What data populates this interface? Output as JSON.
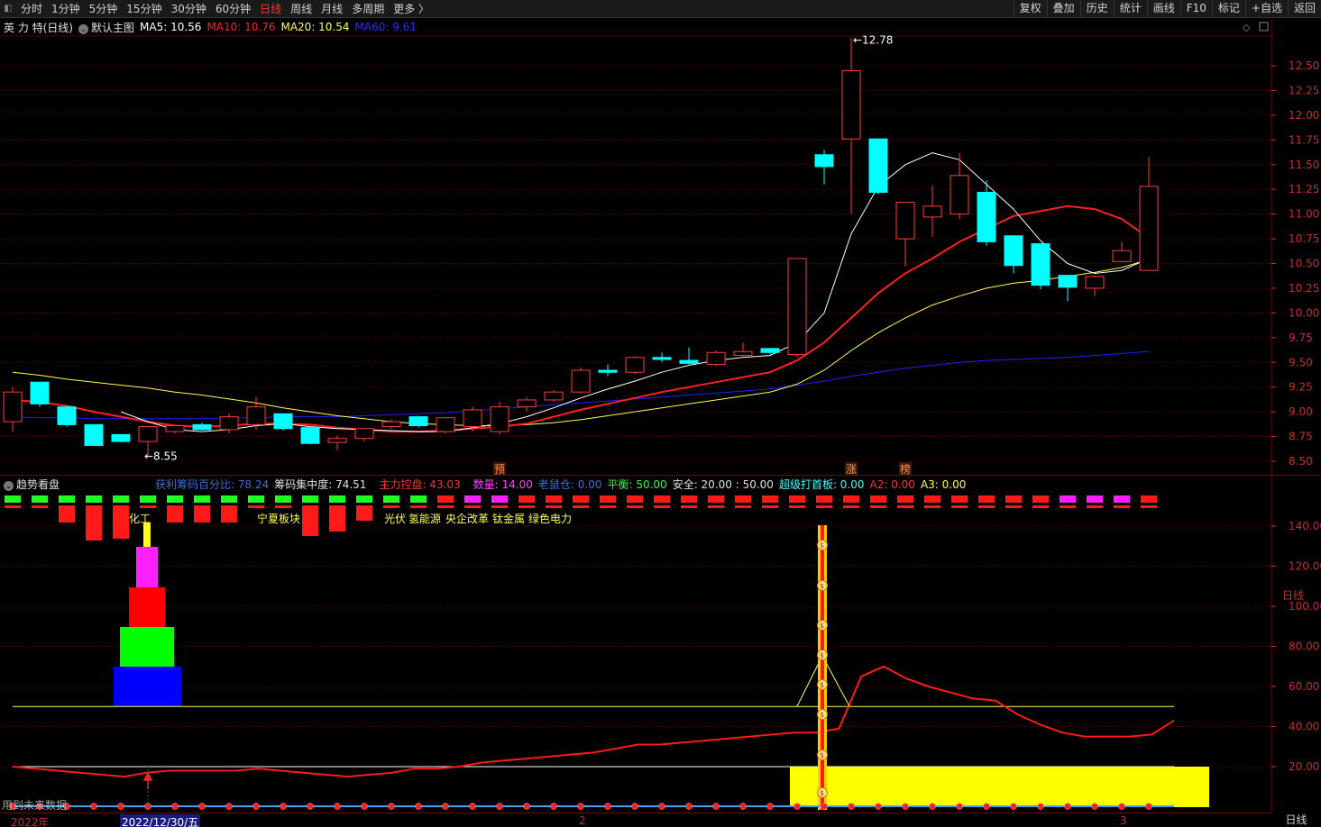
{
  "toolbar": {
    "periods": [
      {
        "label": "分时",
        "active": false
      },
      {
        "label": "1分钟",
        "active": false
      },
      {
        "label": "5分钟",
        "active": false
      },
      {
        "label": "15分钟",
        "active": false
      },
      {
        "label": "30分钟",
        "active": false
      },
      {
        "label": "60分钟",
        "active": false
      },
      {
        "label": "日线",
        "active": true
      },
      {
        "label": "周线",
        "active": false
      },
      {
        "label": "月线",
        "active": false
      },
      {
        "label": "多周期",
        "active": false
      },
      {
        "label": "更多 〉",
        "active": false
      }
    ],
    "right_buttons": [
      "复权",
      "叠加",
      "历史",
      "统计",
      "画线",
      "F10",
      "标记",
      "+自选",
      "返回"
    ]
  },
  "infobar": {
    "stock_name": "英 力 特(日线)",
    "template": "默认主图",
    "ma5": "MA5: 10.56",
    "ma10": "MA10: 10.76",
    "ma20": "MA20: 10.54",
    "ma60": "MA60: 9.61"
  },
  "colors": {
    "up": "#ff3b3b",
    "down": "#00ffff",
    "ma5": "#ffffff",
    "ma10": "#ff2020",
    "ma20": "#ffff50",
    "ma60": "#2020ff",
    "grid": "#5a0000"
  },
  "price_axis": {
    "ticks": [
      12.5,
      12.25,
      12.0,
      11.75,
      11.5,
      11.25,
      11.0,
      10.75,
      10.5,
      10.25,
      10.0,
      9.75,
      9.5,
      9.25,
      9.0,
      8.75,
      8.5
    ]
  },
  "annotations": {
    "high": "12.78",
    "low": "8.55",
    "marker_yu": "预",
    "marker_zhang": "涨",
    "marker_bang": "榜"
  },
  "chart_data": {
    "type": "candlestick",
    "ylim": [
      8.35,
      12.95
    ],
    "candles": [
      {
        "o": 8.9,
        "h": 9.25,
        "l": 8.8,
        "c": 9.2
      },
      {
        "o": 9.3,
        "h": 9.3,
        "l": 9.05,
        "c": 9.08
      },
      {
        "o": 9.05,
        "h": 9.05,
        "l": 8.85,
        "c": 8.87
      },
      {
        "o": 8.87,
        "h": 8.87,
        "l": 8.65,
        "c": 8.66
      },
      {
        "o": 8.77,
        "h": 8.77,
        "l": 8.69,
        "c": 8.7
      },
      {
        "o": 8.7,
        "h": 8.86,
        "l": 8.55,
        "c": 8.85
      },
      {
        "o": 8.8,
        "h": 8.87,
        "l": 8.78,
        "c": 8.86
      },
      {
        "o": 8.87,
        "h": 8.89,
        "l": 8.81,
        "c": 8.82
      },
      {
        "o": 8.82,
        "h": 8.98,
        "l": 8.78,
        "c": 8.95
      },
      {
        "o": 8.87,
        "h": 9.15,
        "l": 8.82,
        "c": 9.05
      },
      {
        "o": 8.98,
        "h": 8.98,
        "l": 8.81,
        "c": 8.83
      },
      {
        "o": 8.84,
        "h": 8.84,
        "l": 8.67,
        "c": 8.68
      },
      {
        "o": 8.69,
        "h": 8.76,
        "l": 8.61,
        "c": 8.73
      },
      {
        "o": 8.73,
        "h": 8.84,
        "l": 8.7,
        "c": 8.83
      },
      {
        "o": 8.85,
        "h": 8.92,
        "l": 8.83,
        "c": 8.9
      },
      {
        "o": 8.95,
        "h": 8.96,
        "l": 8.84,
        "c": 8.86
      },
      {
        "o": 8.8,
        "h": 8.95,
        "l": 8.78,
        "c": 8.94
      },
      {
        "o": 8.85,
        "h": 9.05,
        "l": 8.8,
        "c": 9.02
      },
      {
        "o": 8.8,
        "h": 9.1,
        "l": 8.77,
        "c": 9.05
      },
      {
        "o": 9.05,
        "h": 9.15,
        "l": 9.0,
        "c": 9.12
      },
      {
        "o": 9.12,
        "h": 9.22,
        "l": 9.1,
        "c": 9.2
      },
      {
        "o": 9.2,
        "h": 9.45,
        "l": 9.18,
        "c": 9.42
      },
      {
        "o": 9.42,
        "h": 9.48,
        "l": 9.36,
        "c": 9.4
      },
      {
        "o": 9.4,
        "h": 9.56,
        "l": 9.38,
        "c": 9.55
      },
      {
        "o": 9.55,
        "h": 9.6,
        "l": 9.5,
        "c": 9.53
      },
      {
        "o": 9.52,
        "h": 9.65,
        "l": 9.48,
        "c": 9.49
      },
      {
        "o": 9.48,
        "h": 9.62,
        "l": 9.46,
        "c": 9.6
      },
      {
        "o": 9.57,
        "h": 9.7,
        "l": 9.55,
        "c": 9.61
      },
      {
        "o": 9.64,
        "h": 9.64,
        "l": 9.58,
        "c": 9.6
      },
      {
        "o": 9.58,
        "h": 10.55,
        "l": 9.55,
        "c": 10.55
      },
      {
        "o": 11.6,
        "h": 11.65,
        "l": 11.3,
        "c": 11.48
      },
      {
        "o": 11.76,
        "h": 12.78,
        "l": 11.0,
        "c": 12.45
      },
      {
        "o": 11.76,
        "h": 11.76,
        "l": 11.2,
        "c": 11.22
      },
      {
        "o": 10.75,
        "h": 11.12,
        "l": 10.47,
        "c": 11.12
      },
      {
        "o": 10.97,
        "h": 11.29,
        "l": 10.77,
        "c": 11.08
      },
      {
        "o": 11.0,
        "h": 11.62,
        "l": 10.95,
        "c": 11.39
      },
      {
        "o": 11.22,
        "h": 11.34,
        "l": 10.68,
        "c": 10.72
      },
      {
        "o": 10.78,
        "h": 10.78,
        "l": 10.4,
        "c": 10.48
      },
      {
        "o": 10.7,
        "h": 10.7,
        "l": 10.24,
        "c": 10.28
      },
      {
        "o": 10.38,
        "h": 10.38,
        "l": 10.12,
        "c": 10.26
      },
      {
        "o": 10.25,
        "h": 10.38,
        "l": 10.17,
        "c": 10.37
      },
      {
        "o": 10.52,
        "h": 10.72,
        "l": 10.51,
        "c": 10.63
      },
      {
        "o": 10.43,
        "h": 11.58,
        "l": 10.43,
        "c": 11.28
      }
    ],
    "ma5": [
      null,
      null,
      null,
      null,
      9.0,
      8.9,
      8.82,
      8.8,
      8.82,
      8.86,
      8.88,
      8.85,
      8.83,
      8.82,
      8.81,
      8.8,
      8.8,
      8.84,
      8.88,
      8.95,
      9.04,
      9.14,
      9.23,
      9.31,
      9.4,
      9.47,
      9.52,
      9.55,
      9.57,
      9.7,
      10.0,
      10.8,
      11.28,
      11.5,
      11.62,
      11.55,
      11.3,
      11.05,
      10.73,
      10.5,
      10.4,
      10.43,
      10.55
    ],
    "ma10": [
      9.12,
      9.1,
      9.06,
      9.0,
      8.95,
      8.9,
      8.86,
      8.85,
      8.86,
      8.88,
      8.88,
      8.87,
      8.84,
      8.82,
      8.8,
      8.8,
      8.81,
      8.83,
      8.85,
      8.88,
      8.95,
      9.02,
      9.08,
      9.14,
      9.2,
      9.25,
      9.3,
      9.35,
      9.4,
      9.52,
      9.7,
      9.95,
      10.2,
      10.4,
      10.55,
      10.72,
      10.85,
      10.98,
      11.03,
      11.08,
      11.05,
      10.95,
      10.76
    ],
    "ma20": [
      9.4,
      9.37,
      9.33,
      9.3,
      9.27,
      9.24,
      9.2,
      9.17,
      9.13,
      9.09,
      9.04,
      9.0,
      8.96,
      8.93,
      8.9,
      8.88,
      8.87,
      8.86,
      8.86,
      8.87,
      8.89,
      8.92,
      8.96,
      9.0,
      9.04,
      9.08,
      9.12,
      9.16,
      9.2,
      9.28,
      9.42,
      9.62,
      9.8,
      9.95,
      10.08,
      10.17,
      10.25,
      10.3,
      10.33,
      10.37,
      10.41,
      10.46,
      10.54
    ],
    "ma60": [
      8.95,
      8.94,
      8.94,
      8.93,
      8.93,
      8.93,
      8.93,
      8.93,
      8.94,
      8.94,
      8.95,
      8.95,
      8.95,
      8.96,
      8.97,
      8.98,
      8.99,
      9.01,
      9.03,
      9.05,
      9.07,
      9.09,
      9.11,
      9.13,
      9.15,
      9.17,
      9.19,
      9.21,
      9.23,
      9.27,
      9.31,
      9.36,
      9.4,
      9.44,
      9.47,
      9.5,
      9.52,
      9.53,
      9.54,
      9.55,
      9.57,
      9.59,
      9.61
    ]
  },
  "indicator": {
    "title": "趋势看盘",
    "items": [
      {
        "text": "获利筹码百分比: 78.24",
        "color": "#3a6fd8"
      },
      {
        "text": "筹码集中度: 74.51",
        "color": "#e0e0e0"
      },
      {
        "text": "主力控盘: 43.03",
        "color": "#ff3030"
      },
      {
        "text": "数量: 14.00",
        "color": "#ff40ff"
      },
      {
        "text": "老鼠仓: 0.00",
        "color": "#3a6fd8"
      },
      {
        "text": "平衡: 50.00",
        "color": "#30ff30"
      },
      {
        "text": "安全: 20.00 : 50.00",
        "color": "#e0e0e0"
      },
      {
        "text": "超级打首板: 0.00",
        "color": "#40ffff"
      },
      {
        "text": "A2: 0.00",
        "color": "#ff3030"
      },
      {
        "text": "A3: 0.00",
        "color": "#ffff50"
      }
    ],
    "axis_ticks": [
      "140.00",
      "120.00",
      "100.00",
      "80.00",
      "60.00",
      "40.00",
      "20.00"
    ],
    "tags": [
      "化工",
      "宁夏板块",
      "光伏",
      "氢能源",
      "央企改革",
      "钛金属",
      "绿色电力"
    ],
    "ylim": [
      0,
      150
    ],
    "control_line": [
      20,
      19,
      18,
      17,
      16,
      15,
      17,
      18,
      18,
      18,
      18,
      19,
      18,
      17,
      16,
      15,
      16,
      17,
      19,
      19,
      20,
      22,
      23,
      24,
      25,
      26,
      27,
      29,
      31,
      31,
      32,
      33,
      34,
      35,
      36,
      37,
      37,
      39,
      65,
      70,
      64,
      60,
      57,
      54,
      53,
      46,
      41,
      37,
      35,
      35,
      35,
      36,
      43
    ]
  },
  "bottom": {
    "date_year": "2022年",
    "current_date": "2022/12/30/五",
    "month2": "2",
    "month3": "3",
    "period_label": "日线",
    "future_note": "用到未来数据"
  }
}
